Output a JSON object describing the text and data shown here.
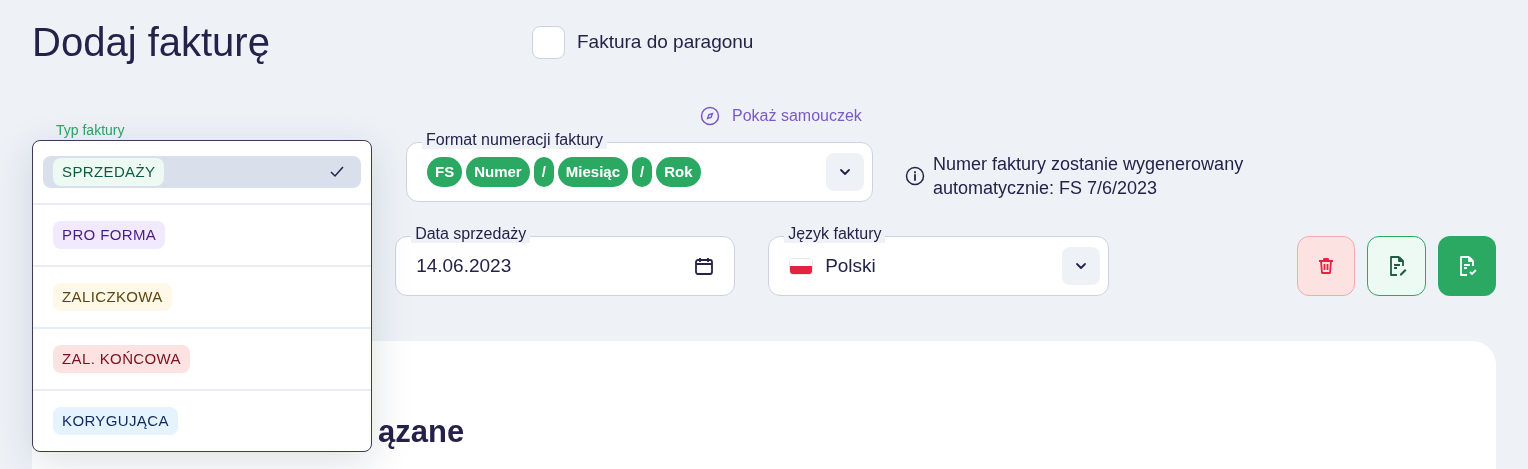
{
  "title": "Dodaj fakturę",
  "receipt_checkbox": {
    "label": "Faktura do paragonu",
    "checked": false
  },
  "tutorial_link": "Pokaż samouczek",
  "invoice_type": {
    "label": "Typ faktury",
    "expanded": true,
    "options": [
      {
        "label": "SPRZEDAŻY",
        "selected": true,
        "color": "#ecfaf3"
      },
      {
        "label": "PRO FORMA",
        "selected": false,
        "color": "#f1e9fd"
      },
      {
        "label": "ZALICZKOWA",
        "selected": false,
        "color": "#fef8e8"
      },
      {
        "label": "ZAL. KOŃCOWA",
        "selected": false,
        "color": "#fde2e2"
      },
      {
        "label": "KORYGUJĄCA",
        "selected": false,
        "color": "#e4f3fe"
      }
    ]
  },
  "numbering_format": {
    "label": "Format numeracji faktury",
    "tokens": [
      "FS",
      "Numer",
      "/",
      "Miesiąc",
      "/",
      "Rok"
    ]
  },
  "info_text": "Numer faktury zostanie wygenerowany automatycznie: FS 7/6/2023",
  "sale_date": {
    "label": "Data sprzedaży",
    "value": "14.06.2023"
  },
  "language": {
    "label": "Język faktury",
    "value": "Polski"
  },
  "card_heading": "ązane"
}
